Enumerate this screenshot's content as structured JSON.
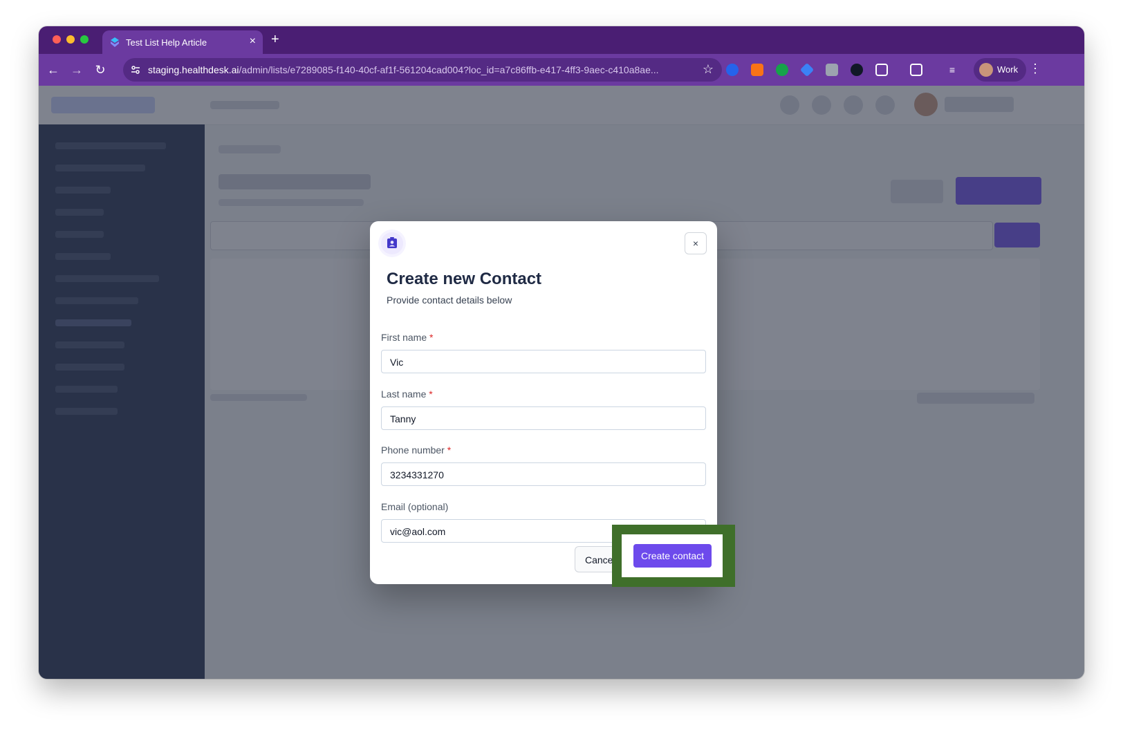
{
  "browser": {
    "tab_title": "Test List Help Article",
    "tab_close": "×",
    "new_tab": "+",
    "url_host": "staging.healthdesk.ai",
    "url_path": "/admin/lists/e7289085-f140-40cf-af1f-561204cad004?loc_id=a7c86ffb-e417-4ff3-9aec-c410a8ae...",
    "profile_label": "Work",
    "icons": [
      "back-icon",
      "forward-icon",
      "reload-icon",
      "site-settings-icon",
      "bookmark-star-icon",
      "extensions-icon",
      "menu-icon"
    ]
  },
  "modal": {
    "title": "Create new Contact",
    "subtitle": "Provide contact details below",
    "close_label": "×",
    "fields": [
      {
        "label": "First name",
        "required": true,
        "value": "Vic"
      },
      {
        "label": "Last name",
        "required": true,
        "value": "Tanny"
      },
      {
        "label": "Phone number",
        "required": true,
        "value": "3234331270"
      },
      {
        "label": "Email (optional)",
        "required": false,
        "value": "vic@aol.com"
      }
    ],
    "required_mark": "*",
    "cancel_label": "Cancel",
    "create_label": "Create contact"
  },
  "colors": {
    "browser_frame": "#6b3aa0",
    "accent": "#6d4aec",
    "highlight": "#3f6f2a",
    "sidebar": "#1e2a4a"
  }
}
